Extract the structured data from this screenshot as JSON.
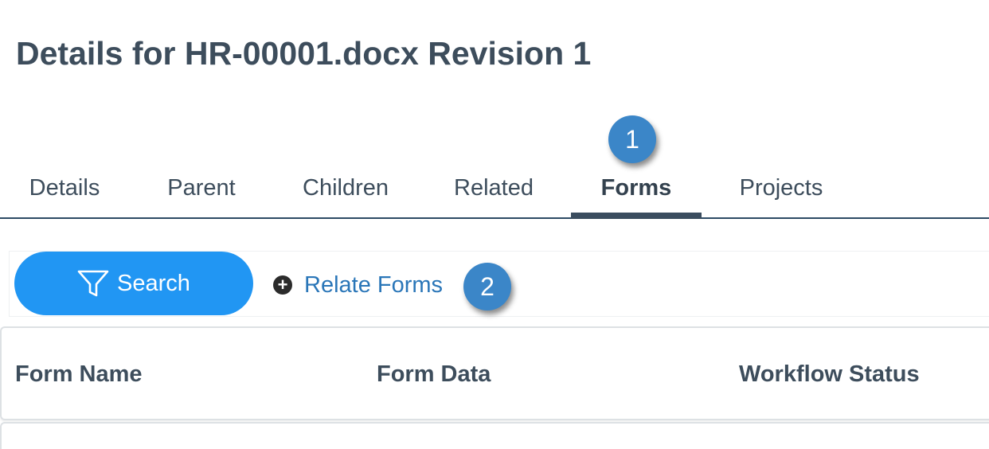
{
  "page": {
    "title": "Details for HR-00001.docx Revision 1"
  },
  "tabs": [
    {
      "label": "Details",
      "active": false
    },
    {
      "label": "Parent",
      "active": false
    },
    {
      "label": "Children",
      "active": false
    },
    {
      "label": "Related",
      "active": false
    },
    {
      "label": "Forms",
      "active": true
    },
    {
      "label": "Projects",
      "active": false
    }
  ],
  "callouts": {
    "step_1": "1",
    "step_2": "2"
  },
  "toolbar": {
    "search_label": "Search",
    "search_icon": "filter-icon",
    "relate_label": "Relate Forms",
    "relate_icon": "plus-circle-icon"
  },
  "table": {
    "columns": [
      "Form Name",
      "Form Data",
      "Workflow Status"
    ],
    "rows": []
  },
  "colors": {
    "accent": "#2196f3",
    "link": "#2a76b8",
    "callout": "#3b86c8",
    "heading": "#3d4d5c",
    "tab_underline": "#3a4c5e"
  }
}
